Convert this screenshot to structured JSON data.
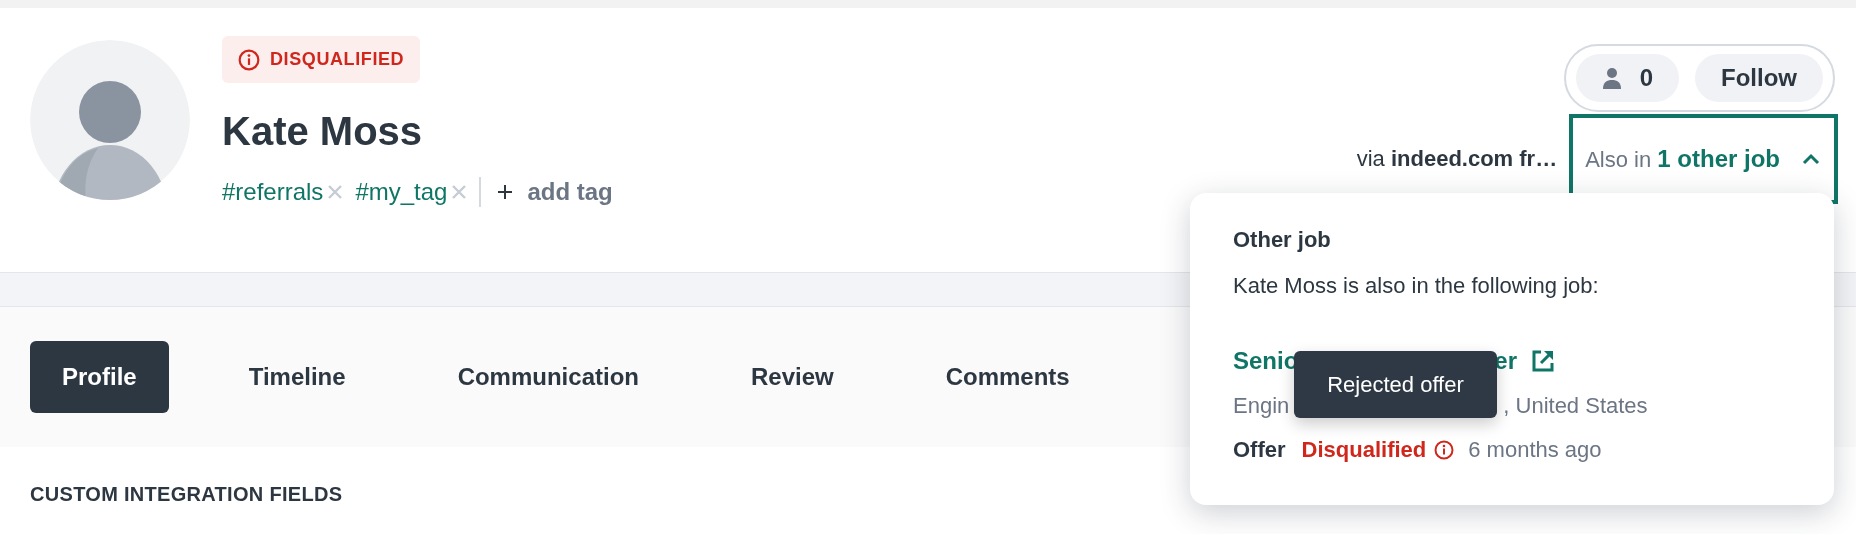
{
  "candidate": {
    "status_badge": "DISQUALIFIED",
    "name": "Kate Moss",
    "tags": [
      {
        "label": "#referrals"
      },
      {
        "label": "#my_tag"
      }
    ],
    "add_tag": "add tag"
  },
  "followers": {
    "count": "0",
    "follow_label": "Follow"
  },
  "source": "via **indeed.com fr…**",
  "other_jobs_toggle": {
    "label": "Also in **1 other job**",
    "expanded": true
  },
  "tabs": [
    {
      "label": "Profile",
      "selected": true
    },
    {
      "label": "Timeline",
      "selected": false
    },
    {
      "label": "Communication",
      "selected": false
    },
    {
      "label": "Review",
      "selected": false
    },
    {
      "label": "Comments",
      "selected": false
    }
  ],
  "section_title": "CUSTOM INTEGRATION FIELDS",
  "popover": {
    "title": "Other job",
    "description": "Kate Moss is also in the following job:",
    "job": {
      "title_parts": [
        "Senio",
        "er"
      ],
      "location_parts": [
        "Engin",
        ", United States"
      ],
      "stage": "Offer",
      "status": "Disqualified",
      "time": "6 months ago"
    },
    "tooltip": "Rejected offer"
  }
}
